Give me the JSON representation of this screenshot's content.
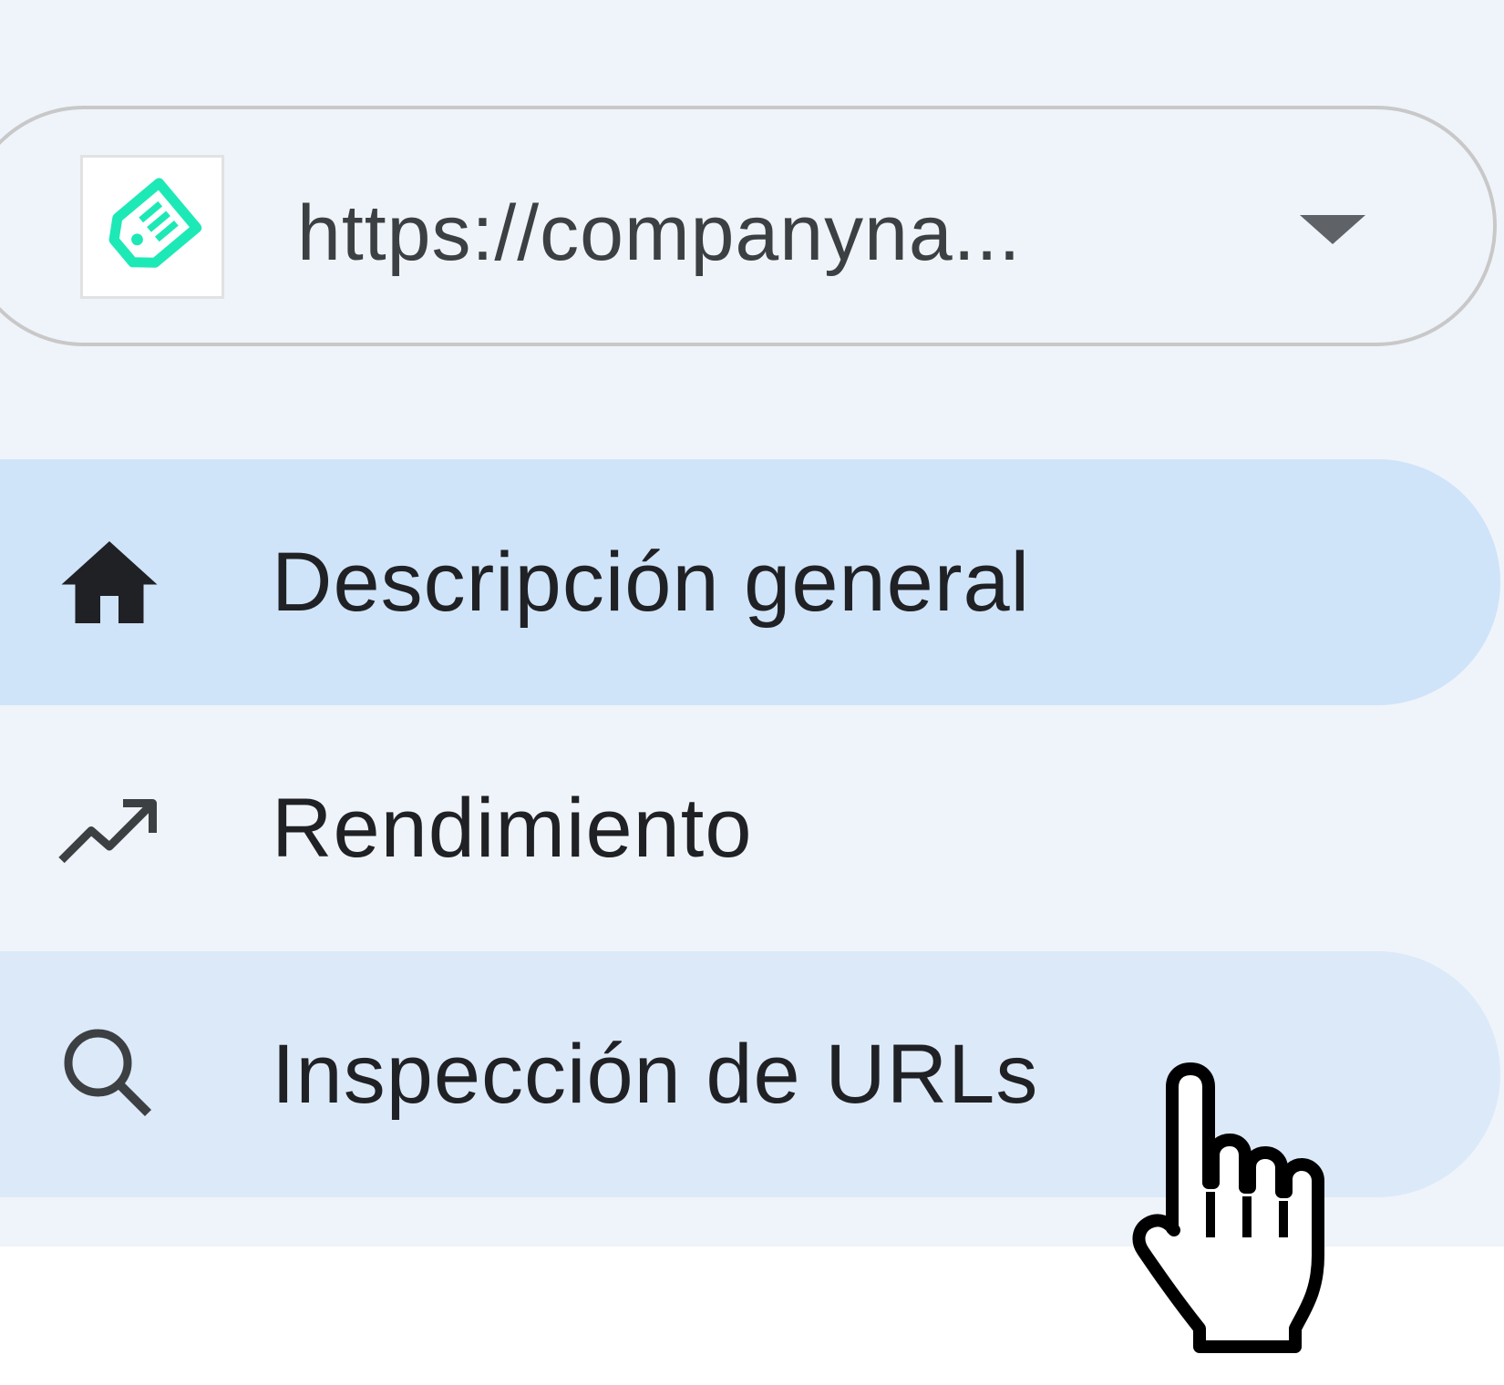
{
  "property_selector": {
    "url": "https://companyna...",
    "favicon_icon": "price-tag-icon",
    "favicon_color": "#1de9b6",
    "dropdown_icon": "triangle-down-icon"
  },
  "nav": {
    "items": [
      {
        "label": "Descripción general",
        "icon": "home-icon",
        "state": "active"
      },
      {
        "label": "Rendimiento",
        "icon": "trending-up-icon",
        "state": "default"
      },
      {
        "label": "Inspección de URLs",
        "icon": "search-icon",
        "state": "hover"
      }
    ]
  },
  "colors": {
    "sidebar_bg": "#eff4fb",
    "active_bg": "#cfe3f9",
    "hover_bg": "#dce9f8",
    "text": "#202124"
  },
  "cursor": "hand-pointer-icon"
}
